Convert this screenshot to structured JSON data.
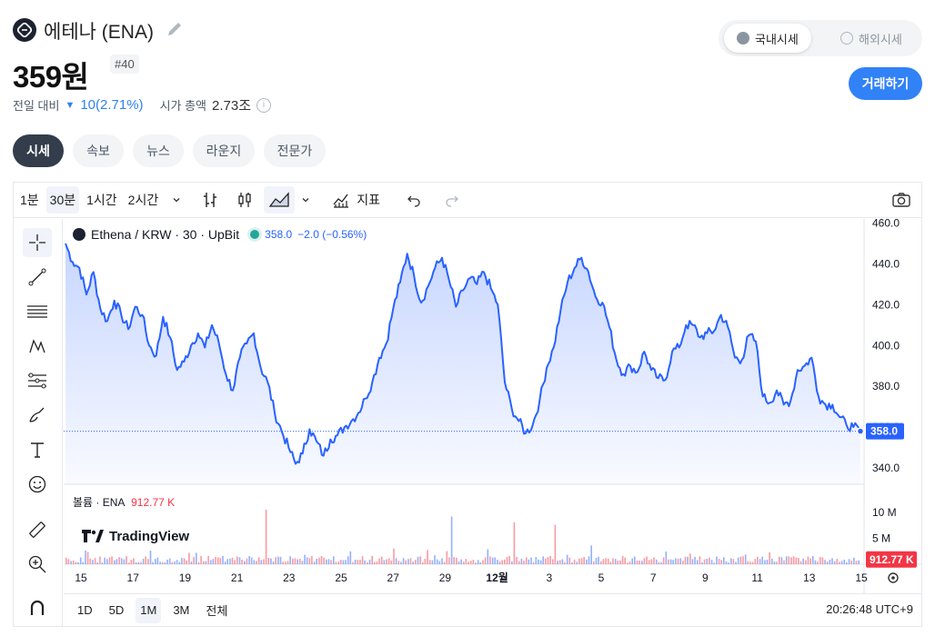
{
  "header": {
    "title": "에테나 (ENA)",
    "price": "359원",
    "rank": "#40",
    "change_label": "전일 대비",
    "change_value": "10(2.71%)",
    "mcap_label": "시가 총액",
    "mcap_value": "2.73조",
    "info_glyph": "i"
  },
  "market_toggle": {
    "domestic": "국내시세",
    "overseas": "해외시세"
  },
  "trade_button": "거래하기",
  "tabs": [
    "시세",
    "속보",
    "뉴스",
    "라운지",
    "전문가"
  ],
  "toolbar": {
    "intervals": [
      "1분",
      "30분",
      "1시간",
      "2시간"
    ],
    "selected_interval": "30분",
    "indicators_label": "지표"
  },
  "legend": {
    "symbol": "Ethena / KRW · 30 · UpBit",
    "value": "358.0",
    "change": "−2.0 (−0.56%)"
  },
  "volume_legend": {
    "label": "볼륨 · ENA",
    "value": "912.77 K"
  },
  "tradingview_label": "TradingView",
  "ranges": [
    "1D",
    "5D",
    "1M",
    "3M",
    "전체"
  ],
  "selected_range": "1M",
  "clock": "20:26:48 UTC+9",
  "colors": {
    "accent": "#3182f6",
    "line": "#2962ff",
    "up": "#f23645",
    "down": "#2962ff"
  },
  "chart_data": {
    "type": "area",
    "title": "",
    "price_axis": [
      "460.0",
      "440.0",
      "420.0",
      "400.0",
      "380.0",
      "360.0",
      "340.0"
    ],
    "ylim": [
      332,
      462
    ],
    "x_ticks": [
      "15",
      "17",
      "19",
      "21",
      "23",
      "25",
      "27",
      "29",
      "12월",
      "3",
      "5",
      "7",
      "9",
      "11",
      "13",
      "15"
    ],
    "series": [
      {
        "values": [
          450,
          441,
          438,
          425,
          436,
          418,
          412,
          422,
          415,
          408,
          419,
          415,
          400,
          395,
          414,
          404,
          388,
          392,
          400,
          406,
          399,
          410,
          401,
          386,
          378,
          394,
          401,
          406,
          389,
          382,
          367,
          358,
          350,
          342,
          347,
          359,
          353,
          346,
          354,
          356,
          360,
          363,
          367,
          374,
          382,
          394,
          401,
          418,
          431,
          445,
          434,
          421,
          429,
          438,
          443,
          432,
          419,
          427,
          433,
          430,
          436,
          428,
          420,
          382,
          369,
          363,
          357,
          361,
          373,
          389,
          399,
          417,
          431,
          438,
          443,
          436,
          424,
          421,
          409,
          393,
          386,
          390,
          387,
          397,
          388,
          384,
          383,
          397,
          399,
          410,
          410,
          404,
          406,
          407,
          415,
          409,
          394,
          393,
          405,
          402,
          375,
          372,
          378,
          371,
          373,
          388,
          390,
          394,
          375,
          371,
          371,
          365,
          361,
          360,
          358
        ]
      }
    ],
    "last_value": "358.0",
    "volume_axis": [
      "10 M",
      "5 M"
    ],
    "volume_last": "912.77 K",
    "volume_ylim": [
      0,
      14
    ]
  }
}
